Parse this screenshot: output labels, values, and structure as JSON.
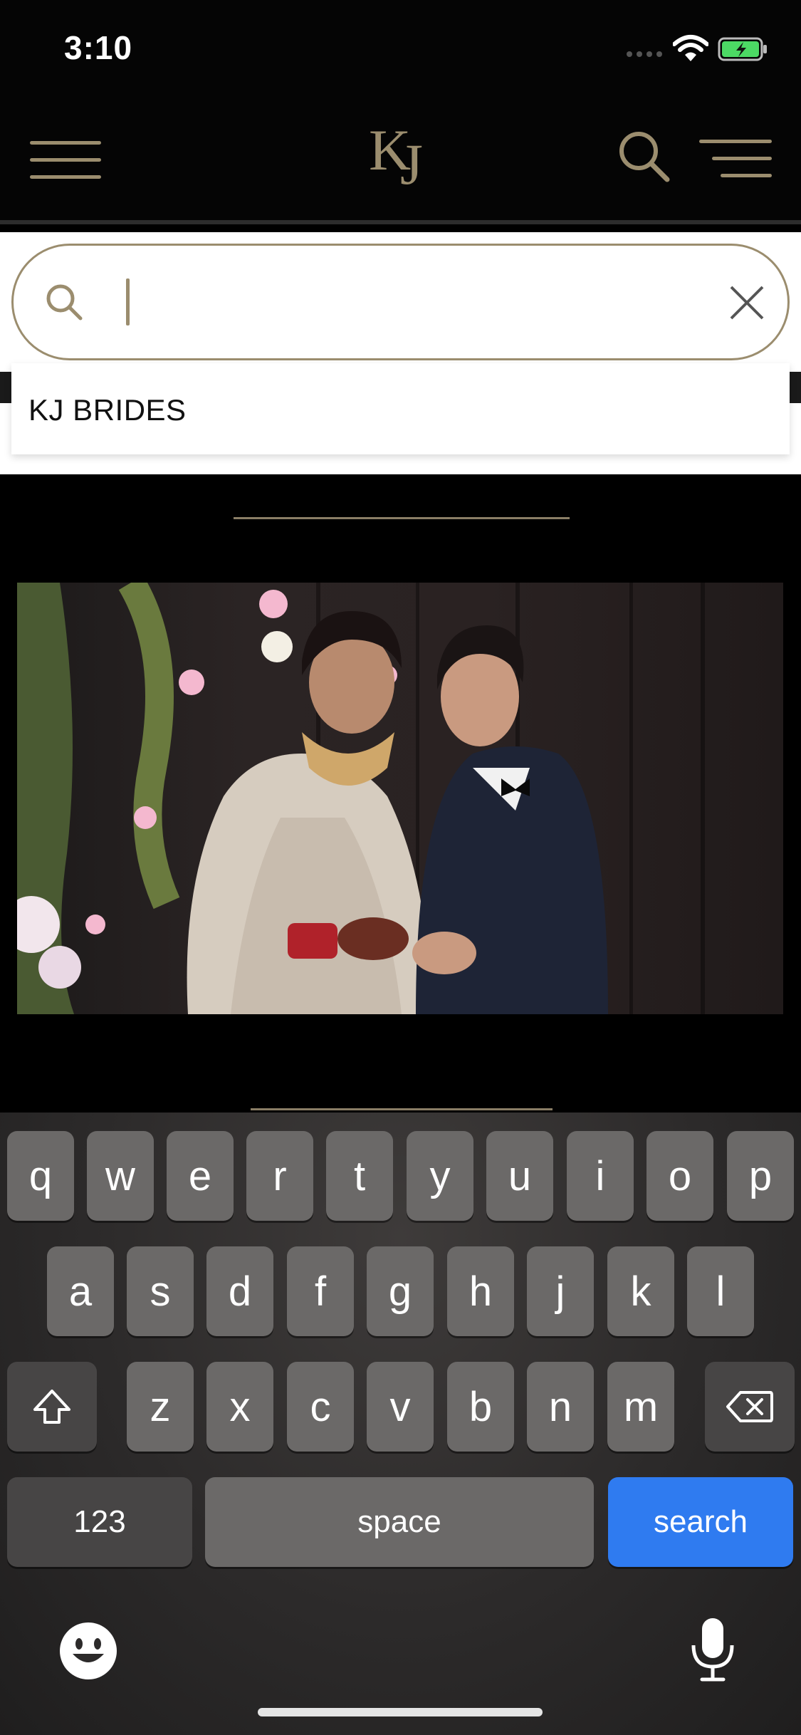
{
  "status_bar": {
    "time": "3:10"
  },
  "header": {
    "logo_text_k": "K",
    "logo_text_j": "J"
  },
  "search": {
    "placeholder": "",
    "value": ""
  },
  "suggestions": [
    {
      "label": "KJ BRIDES"
    }
  ],
  "keyboard": {
    "row1": [
      "q",
      "w",
      "e",
      "r",
      "t",
      "y",
      "u",
      "i",
      "o",
      "p"
    ],
    "row2": [
      "a",
      "s",
      "d",
      "f",
      "g",
      "h",
      "j",
      "k",
      "l"
    ],
    "row3": [
      "z",
      "x",
      "c",
      "v",
      "b",
      "n",
      "m"
    ],
    "numbers_label": "123",
    "space_label": "space",
    "search_label": "search"
  },
  "colors": {
    "accent_gold": "#9b8d6e",
    "search_key_blue": "#2f7bf0",
    "battery_green": "#4cd964"
  }
}
